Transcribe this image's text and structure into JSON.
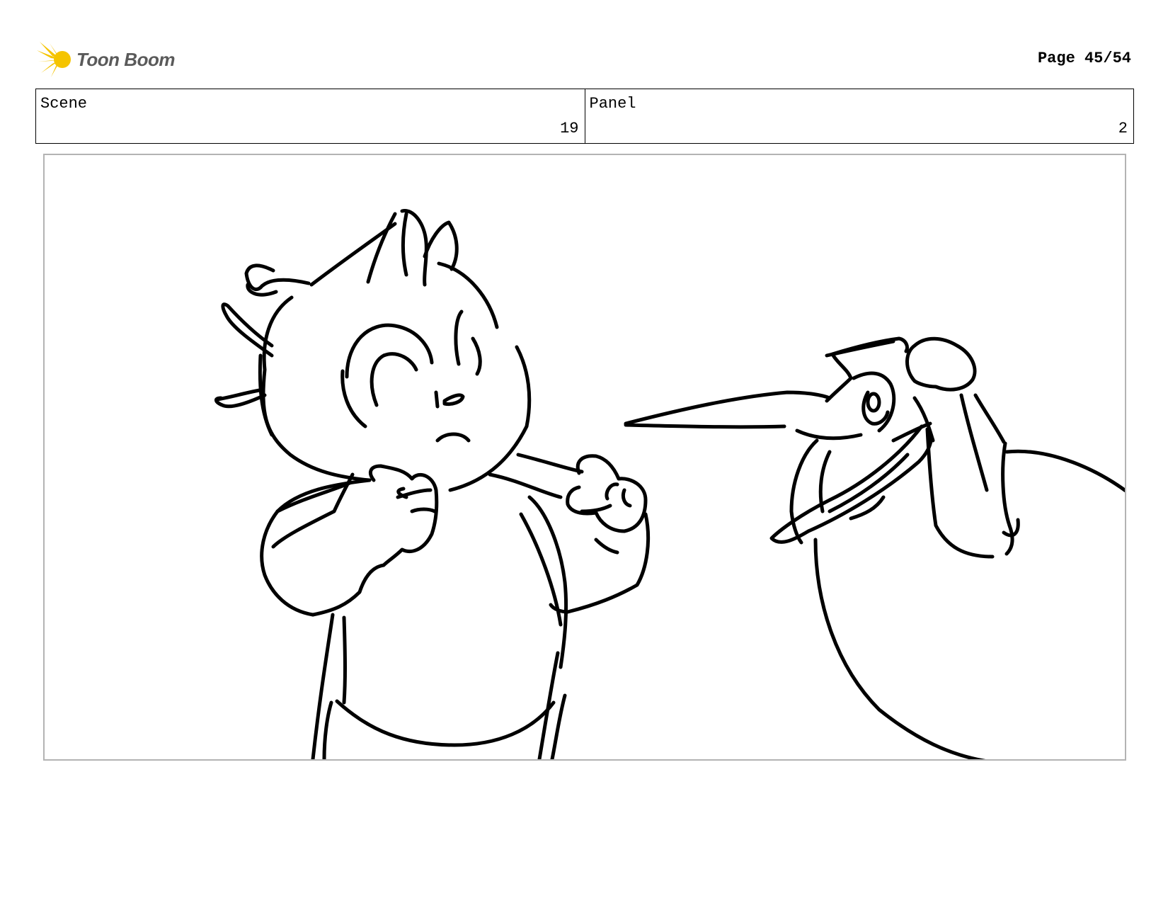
{
  "header": {
    "logo_text": "Toon Boom",
    "logo_icon": "starburst-icon",
    "logo_color": "#f5c400",
    "page_label": "Page 45/54"
  },
  "info": {
    "scene_label": "Scene",
    "scene_value": "19",
    "panel_label": "Panel",
    "panel_value": "2"
  },
  "panel": {
    "border_color": "#b3b3b3",
    "content": "rough-sketch-drawing"
  }
}
